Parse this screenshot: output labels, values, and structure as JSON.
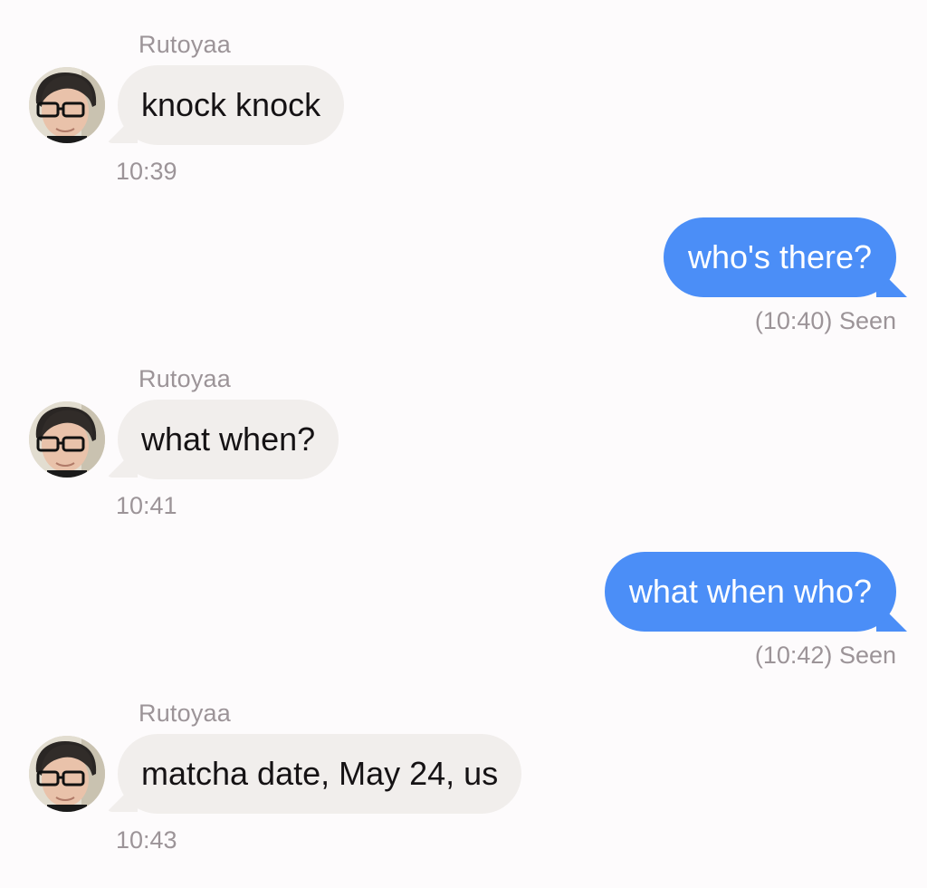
{
  "conversation": {
    "messages": [
      {
        "direction": "incoming",
        "sender": "Rutoyaa",
        "text": "knock knock",
        "time": "10:39",
        "avatar_icon": "user-avatar-icon"
      },
      {
        "direction": "outgoing",
        "text": "who's there?",
        "time": "(10:40)",
        "status": "Seen"
      },
      {
        "direction": "incoming",
        "sender": "Rutoyaa",
        "text": "what when?",
        "time": "10:41",
        "avatar_icon": "user-avatar-icon"
      },
      {
        "direction": "outgoing",
        "text": "what when who?",
        "time": "(10:42)",
        "status": "Seen"
      },
      {
        "direction": "incoming",
        "sender": "Rutoyaa",
        "text": "matcha date, May 24, us",
        "time": "10:43",
        "avatar_icon": "user-avatar-icon"
      }
    ]
  },
  "colors": {
    "background": "#fdfbfc",
    "incoming_bubble": "#f1eeec",
    "outgoing_bubble": "#4b8ef7",
    "meta_text": "#9c9498"
  }
}
